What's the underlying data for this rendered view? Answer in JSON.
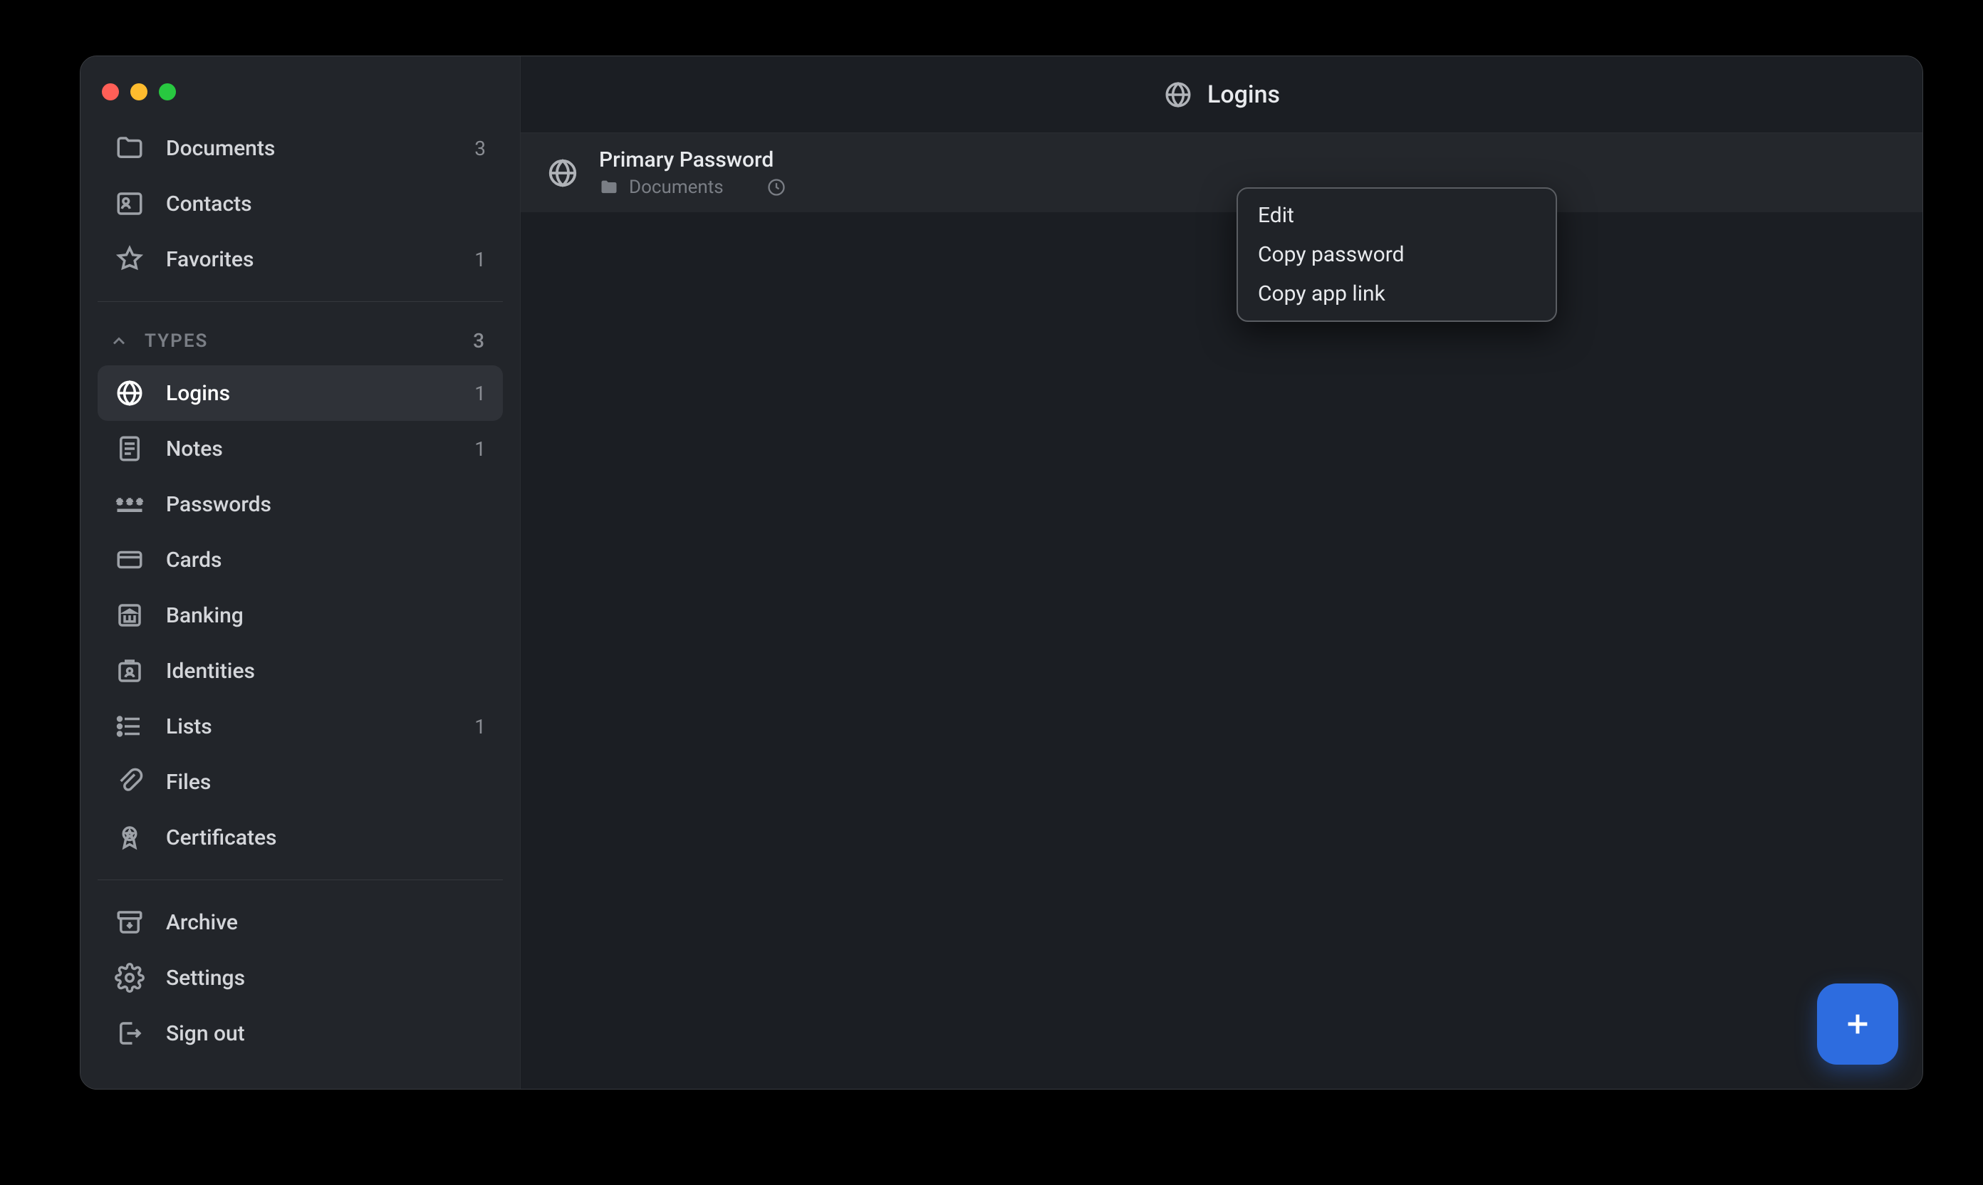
{
  "header": {
    "title": "Logins"
  },
  "sidebar": {
    "top": [
      {
        "label": "Documents",
        "count": "3",
        "icon": "folder"
      },
      {
        "label": "Contacts",
        "count": "",
        "icon": "contact"
      },
      {
        "label": "Favorites",
        "count": "1",
        "icon": "star"
      }
    ],
    "types_header": {
      "title": "TYPES",
      "count": "3"
    },
    "types": [
      {
        "label": "Logins",
        "count": "1",
        "icon": "globe",
        "selected": true
      },
      {
        "label": "Notes",
        "count": "1",
        "icon": "note"
      },
      {
        "label": "Passwords",
        "count": "",
        "icon": "password"
      },
      {
        "label": "Cards",
        "count": "",
        "icon": "card"
      },
      {
        "label": "Banking",
        "count": "",
        "icon": "bank"
      },
      {
        "label": "Identities",
        "count": "",
        "icon": "id"
      },
      {
        "label": "Lists",
        "count": "1",
        "icon": "list"
      },
      {
        "label": "Files",
        "count": "",
        "icon": "file"
      },
      {
        "label": "Certificates",
        "count": "",
        "icon": "cert"
      }
    ],
    "bottom": [
      {
        "label": "Archive",
        "icon": "archive"
      },
      {
        "label": "Settings",
        "icon": "settings"
      },
      {
        "label": "Sign out",
        "icon": "signout"
      }
    ]
  },
  "item": {
    "title": "Primary Password",
    "folder": "Documents"
  },
  "context_menu": {
    "items": [
      "Edit",
      "Copy password",
      "Copy app link"
    ]
  }
}
